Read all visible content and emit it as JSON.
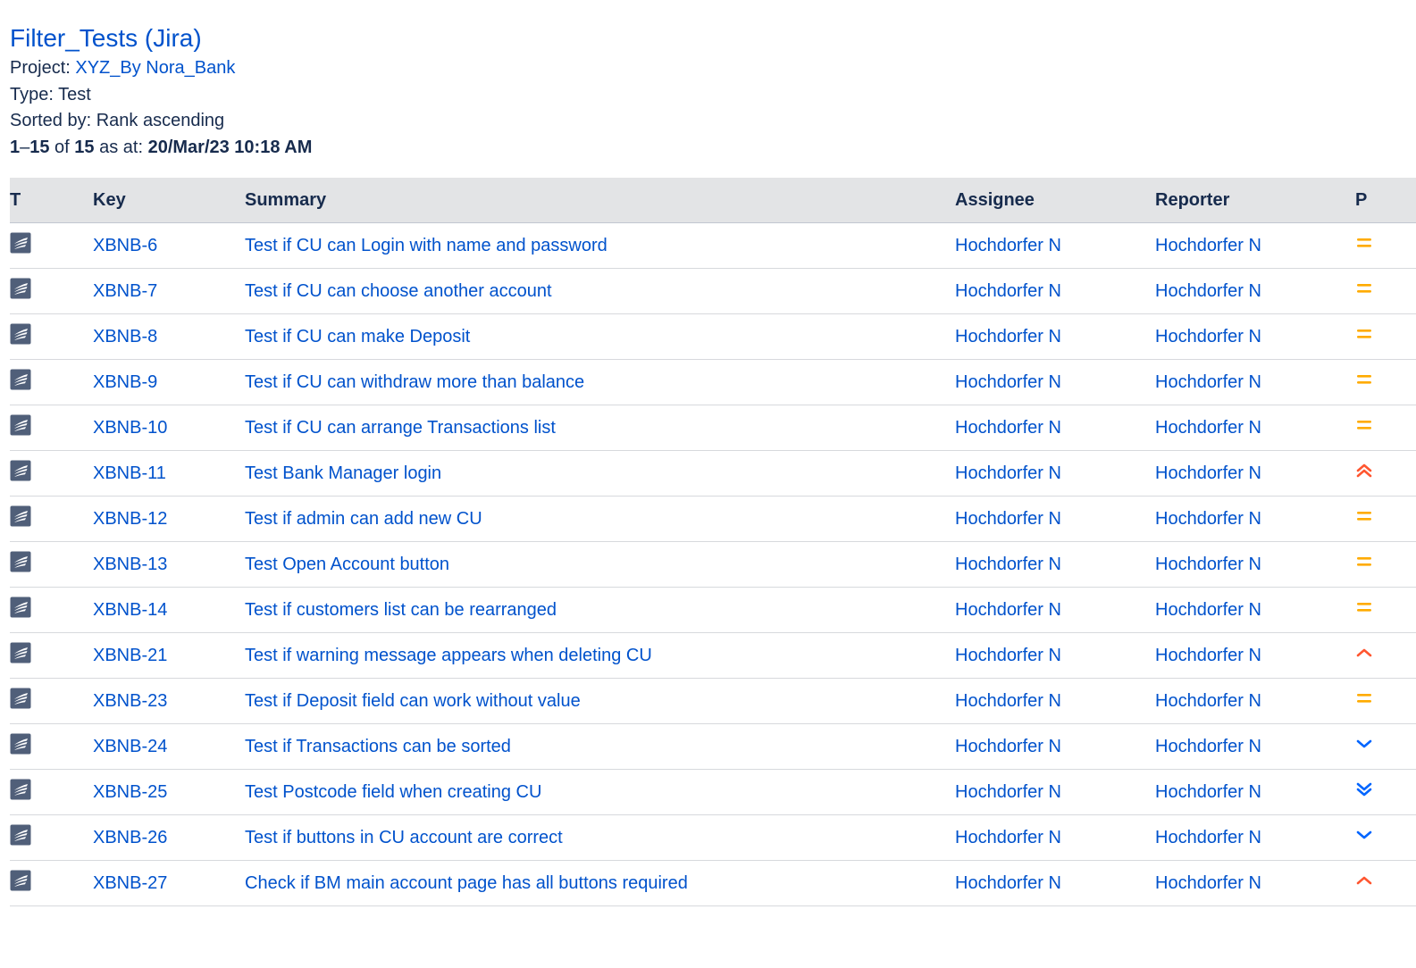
{
  "header": {
    "title": "Filter_Tests (Jira)",
    "project_label": "Project:",
    "project_name": "XYZ_By Nora_Bank",
    "type_line": "Type: Test",
    "sorted_line": "Sorted by: Rank ascending",
    "range_start": "1",
    "range_dash": "–",
    "range_end": "15",
    "of_text": " of ",
    "total": "15",
    "as_at_text": " as at: ",
    "timestamp": "20/Mar/23 10:18 AM"
  },
  "columns": {
    "type": "T",
    "key": "Key",
    "summary": "Summary",
    "assignee": "Assignee",
    "reporter": "Reporter",
    "priority": "P"
  },
  "type_icon": "test-issue-type-icon",
  "priority_icons": {
    "medium": {
      "icon": "equals-icon",
      "color": "#ffab00"
    },
    "high": {
      "icon": "chevron-up-icon",
      "color": "#ff5630"
    },
    "highest": {
      "icon": "double-chevron-up-icon",
      "color": "#ff5630"
    },
    "low": {
      "icon": "chevron-down-icon",
      "color": "#0065ff"
    },
    "lowest": {
      "icon": "double-chevron-down-icon",
      "color": "#0065ff"
    }
  },
  "issues": [
    {
      "key": "XBNB-6",
      "summary": "Test if CU can Login with name and password",
      "assignee": "Hochdorfer N",
      "reporter": "Hochdorfer N",
      "priority": "medium"
    },
    {
      "key": "XBNB-7",
      "summary": "Test if CU can choose another account",
      "assignee": "Hochdorfer N",
      "reporter": "Hochdorfer N",
      "priority": "medium"
    },
    {
      "key": "XBNB-8",
      "summary": "Test if CU can make Deposit",
      "assignee": "Hochdorfer N",
      "reporter": "Hochdorfer N",
      "priority": "medium"
    },
    {
      "key": "XBNB-9",
      "summary": "Test if CU can withdraw more than balance",
      "assignee": "Hochdorfer N",
      "reporter": "Hochdorfer N",
      "priority": "medium"
    },
    {
      "key": "XBNB-10",
      "summary": "Test if CU can arrange Transactions list",
      "assignee": "Hochdorfer N",
      "reporter": "Hochdorfer N",
      "priority": "medium"
    },
    {
      "key": "XBNB-11",
      "summary": "Test Bank Manager login",
      "assignee": "Hochdorfer N",
      "reporter": "Hochdorfer N",
      "priority": "highest"
    },
    {
      "key": "XBNB-12",
      "summary": "Test if admin can add new CU",
      "assignee": "Hochdorfer N",
      "reporter": "Hochdorfer N",
      "priority": "medium"
    },
    {
      "key": "XBNB-13",
      "summary": "Test Open Account button",
      "assignee": "Hochdorfer N",
      "reporter": "Hochdorfer N",
      "priority": "medium"
    },
    {
      "key": "XBNB-14",
      "summary": "Test if customers list can be rearranged",
      "assignee": "Hochdorfer N",
      "reporter": "Hochdorfer N",
      "priority": "medium"
    },
    {
      "key": "XBNB-21",
      "summary": "Test if warning message appears when deleting CU",
      "assignee": "Hochdorfer N",
      "reporter": "Hochdorfer N",
      "priority": "high"
    },
    {
      "key": "XBNB-23",
      "summary": "Test if Deposit field can work without value",
      "assignee": "Hochdorfer N",
      "reporter": "Hochdorfer N",
      "priority": "medium"
    },
    {
      "key": "XBNB-24",
      "summary": "Test if Transactions can be sorted",
      "assignee": "Hochdorfer N",
      "reporter": "Hochdorfer N",
      "priority": "low"
    },
    {
      "key": "XBNB-25",
      "summary": "Test Postcode field when creating CU",
      "assignee": "Hochdorfer N",
      "reporter": "Hochdorfer N",
      "priority": "lowest"
    },
    {
      "key": "XBNB-26",
      "summary": "Test if buttons in CU account are correct",
      "assignee": "Hochdorfer N",
      "reporter": "Hochdorfer N",
      "priority": "low"
    },
    {
      "key": "XBNB-27",
      "summary": "Check if BM main account page has all buttons required",
      "assignee": "Hochdorfer N",
      "reporter": "Hochdorfer N",
      "priority": "high"
    }
  ]
}
